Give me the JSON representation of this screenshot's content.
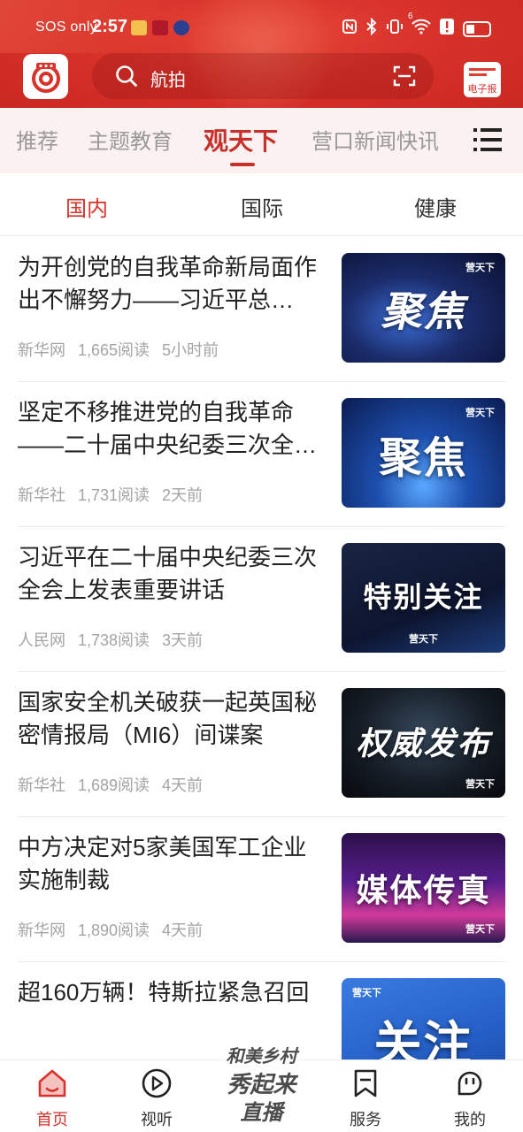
{
  "status_bar": {
    "carrier": "SOS only",
    "time": "2:57",
    "signal_superscript": "6"
  },
  "header": {
    "search_query": "航拍",
    "epaper_label": "电子报",
    "accent_color": "#d8322a"
  },
  "channels": [
    {
      "label": "推荐",
      "active": false
    },
    {
      "label": "主题教育",
      "active": false
    },
    {
      "label": "观天下",
      "active": true
    },
    {
      "label": "营口新闻快讯",
      "active": false
    }
  ],
  "subtabs": [
    {
      "label": "国内",
      "active": true
    },
    {
      "label": "国际",
      "active": false
    },
    {
      "label": "健康",
      "active": false
    }
  ],
  "news": [
    {
      "title": "为开创党的自我革命新局面作出不懈努力——习近平总…",
      "source": "新华网",
      "reads": "1,665阅读",
      "time": "5小时前",
      "thumb_text": "聚焦",
      "thumb_brand": "营天下"
    },
    {
      "title": "坚定不移推进党的自我革命——二十届中央纪委三次全…",
      "source": "新华社",
      "reads": "1,731阅读",
      "time": "2天前",
      "thumb_text": "聚焦",
      "thumb_brand": "营天下"
    },
    {
      "title": "习近平在二十届中央纪委三次全会上发表重要讲话",
      "source": "人民网",
      "reads": "1,738阅读",
      "time": "3天前",
      "thumb_text": "特别关注",
      "thumb_brand": "营天下"
    },
    {
      "title": "国家安全机关破获一起英国秘密情报局（MI6）间谍案",
      "source": "新华社",
      "reads": "1,689阅读",
      "time": "4天前",
      "thumb_text": "权威发布",
      "thumb_brand": "营天下"
    },
    {
      "title": "中方决定对5家美国军工企业实施制裁",
      "source": "新华网",
      "reads": "1,890阅读",
      "time": "4天前",
      "thumb_text": "媒体传真",
      "thumb_brand": "营天下"
    },
    {
      "title": "超160万辆！特斯拉紧急召回",
      "source": "",
      "reads": "",
      "time": "",
      "thumb_text": "关注",
      "thumb_brand": "营天下"
    }
  ],
  "bottom_nav": [
    {
      "label": "首页",
      "icon": "home-icon",
      "active": true
    },
    {
      "label": "视听",
      "icon": "play-circle-icon",
      "active": false
    },
    {
      "label": "服务",
      "icon": "bookmark-icon",
      "active": false
    },
    {
      "label": "我的",
      "icon": "profile-face-icon",
      "active": false
    }
  ],
  "live_badge": {
    "line1": "和美乡村",
    "line2": "秀起来",
    "line3": "直播"
  }
}
